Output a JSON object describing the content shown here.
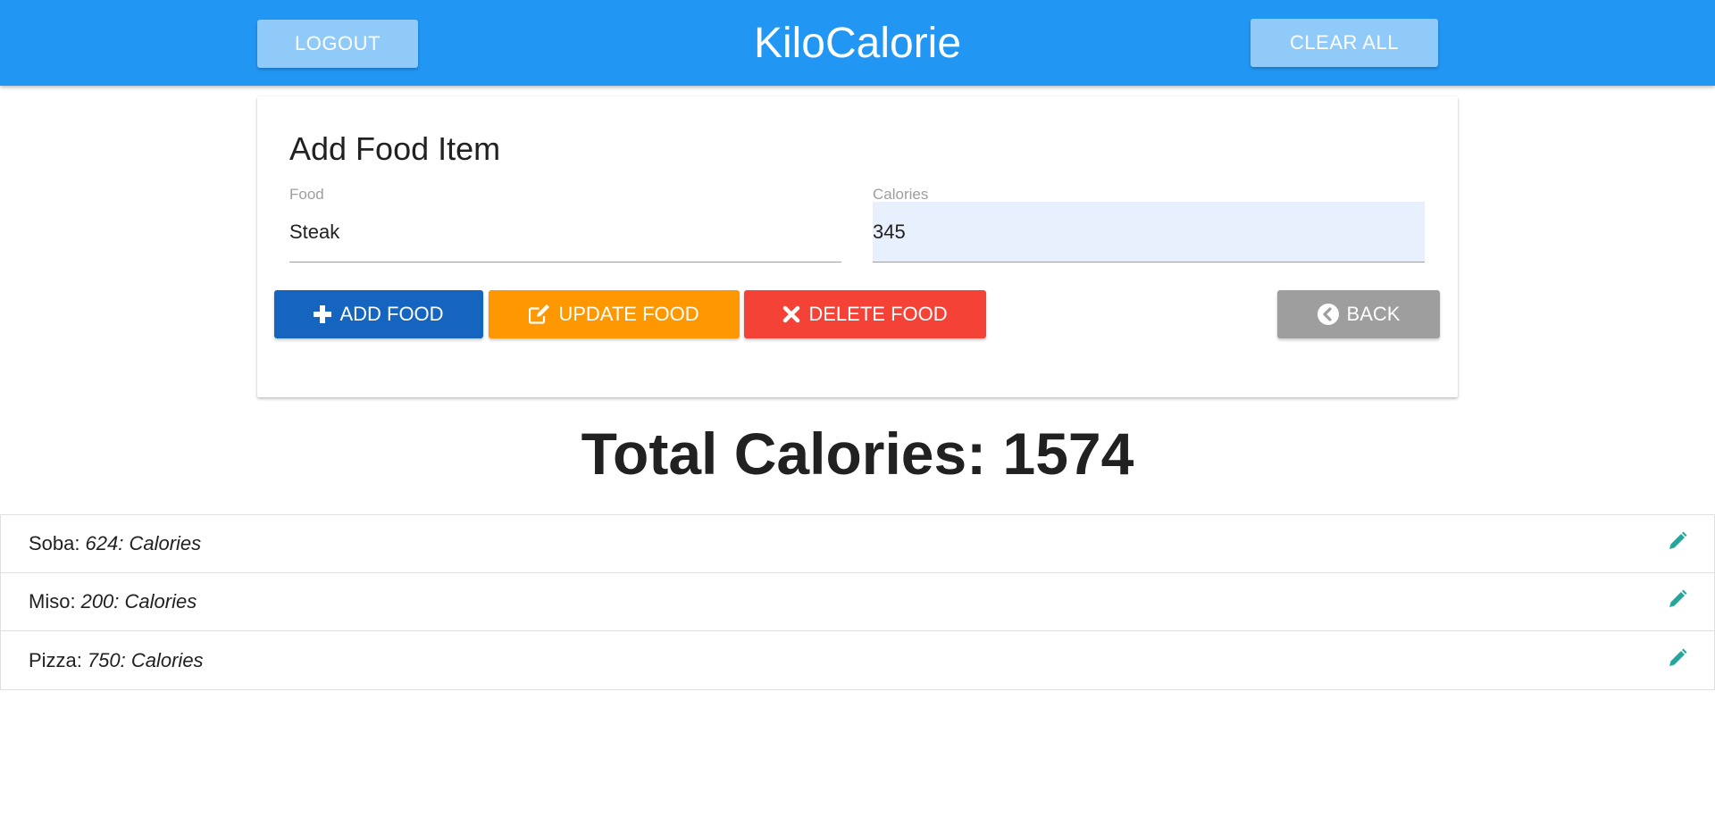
{
  "navbar": {
    "brand": "KiloCalorie",
    "logout_label": "LOGOUT",
    "clear_all_label": "CLEAR ALL",
    "bg_color": "#2196f3",
    "button_color": "#90caf9"
  },
  "form": {
    "title": "Add Food Item",
    "food_label": "Food",
    "food_value": "Steak",
    "calories_label": "Calories",
    "calories_value": "345",
    "buttons": {
      "add": {
        "label": "ADD FOOD",
        "icon": "plus-icon",
        "color": "#1565c0"
      },
      "update": {
        "label": "UPDATE FOOD",
        "icon": "edit-icon",
        "color": "#ff9800"
      },
      "delete": {
        "label": "DELETE FOOD",
        "icon": "close-icon",
        "color": "#f44336"
      },
      "back": {
        "label": "BACK",
        "icon": "chevron-circle-left-icon",
        "color": "#9e9e9e"
      }
    }
  },
  "total": {
    "label": "Total Calories:",
    "value": "1574"
  },
  "items": [
    {
      "name": "Soba",
      "calories": "624: Calories"
    },
    {
      "name": "Miso",
      "calories": "200: Calories"
    },
    {
      "name": "Pizza",
      "calories": "750: Calories"
    }
  ],
  "edit_icon": {
    "icon": "pencil-icon",
    "color": "#26a69a"
  }
}
